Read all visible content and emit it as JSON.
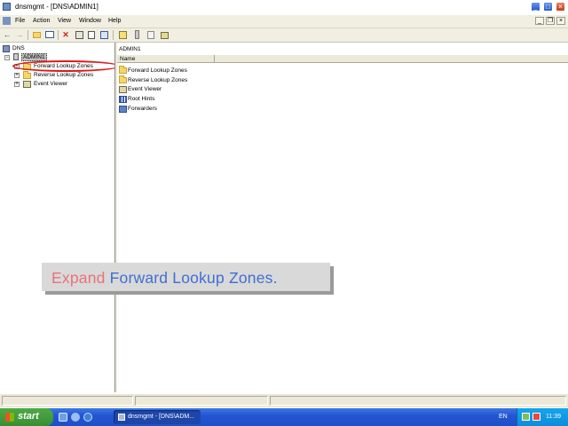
{
  "window": {
    "title": "dnsmgmt - [DNS\\ADMIN1]",
    "controls": {
      "minimize": "_",
      "maximize": "□",
      "close": "×"
    }
  },
  "menu": {
    "items": [
      "File",
      "Action",
      "View",
      "Window",
      "Help"
    ],
    "mdi_controls": {
      "minimize": "_",
      "restore": "❐",
      "close": "×"
    }
  },
  "toolbar": {
    "icons": [
      "back-icon",
      "forward-icon",
      "up-icon",
      "show-tree-icon",
      "delete-icon",
      "properties-icon",
      "refresh-icon",
      "export-icon",
      "help-icon",
      "server-icon",
      "zone-icon",
      "record-icon",
      "update-icon"
    ],
    "delete_glyph": "✕"
  },
  "tree": {
    "root": "DNS",
    "server": "ADMIN1",
    "children": [
      "Forward Lookup Zones",
      "Reverse Lookup Zones",
      "Event Viewer"
    ],
    "expander_glyph": "+",
    "collapse_glyph": "−"
  },
  "list": {
    "caption": "ADMIN1",
    "column": "Name",
    "items": [
      "Forward Lookup Zones",
      "Reverse Lookup Zones",
      "Event Viewer",
      "Root Hints",
      "Forwarders"
    ]
  },
  "instruction": {
    "verb": "Expand",
    "rest": "Forward Lookup Zones."
  },
  "taskbar": {
    "start": "start",
    "task_button": "dnsmgmt - [DNS\\ADM...",
    "language": "EN",
    "clock": "11:39"
  },
  "colors": {
    "highlight_ring": "#e01919",
    "instruction_verb": "#e8727c",
    "instruction_rest": "#3f6fd1",
    "taskbar": "#2456d2",
    "start_button": "#3a8d34"
  }
}
